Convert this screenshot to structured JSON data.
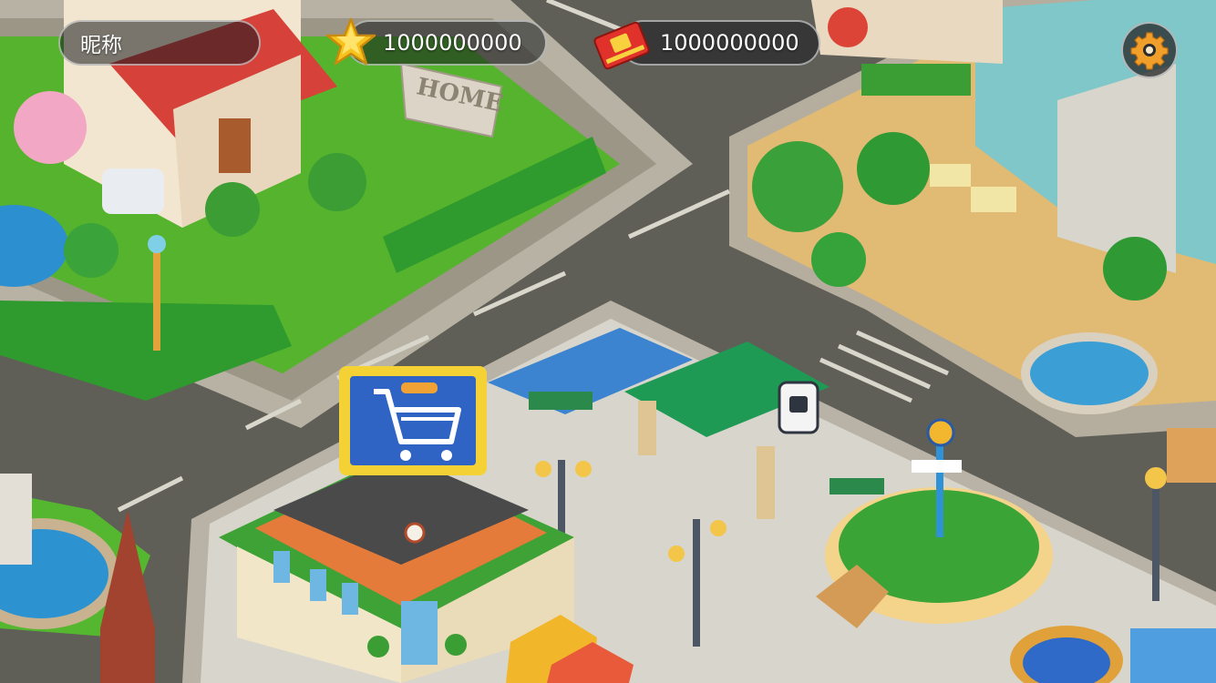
{
  "hud": {
    "nickname": "昵称",
    "stars": "1000000000",
    "redpacket": "1000000000"
  },
  "scene": {
    "sign_text": "HOME"
  },
  "icons": {
    "star": "star-icon",
    "redpacket": "red-packet-icon",
    "settings": "gear-icon"
  },
  "colors": {
    "road": "#5e5d56",
    "grass": "#4faa2c",
    "hedge": "#2f9b2f",
    "shop_sign": "#2f64c5",
    "bus_roof": "#1f9a55",
    "hud_bg": "rgba(20,24,28,0.55)"
  }
}
